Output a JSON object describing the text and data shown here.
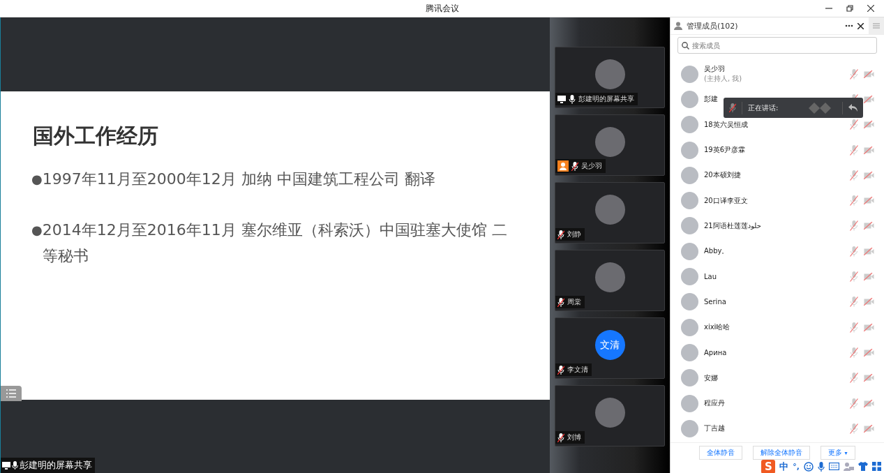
{
  "window": {
    "title": "腾讯会议"
  },
  "slide": {
    "title": "国外工作经历",
    "bullets": [
      {
        "marker": "●",
        "text": "1997年11月至2000年12月  加纳 中国建筑工程公司 翻译"
      },
      {
        "marker": "●",
        "text": "2014年12月至2016年11月  塞尔维亚（科索沃）中国驻塞大使馆 二等秘书"
      }
    ]
  },
  "share_label": {
    "text": "彭建明的屏幕共享",
    "mic_muted": false
  },
  "tiles": [
    {
      "name": "彭建明的屏幕共享",
      "avatar": {
        "kind": "photo"
      },
      "sharing": true,
      "host": false,
      "mic_muted": false
    },
    {
      "name": "吴少羽",
      "avatar": {
        "kind": "photo"
      },
      "sharing": false,
      "host": true,
      "mic_muted": true
    },
    {
      "name": "刘静",
      "avatar": {
        "kind": "photo"
      },
      "sharing": false,
      "host": false,
      "mic_muted": true
    },
    {
      "name": "周棠",
      "avatar": {
        "kind": "photo"
      },
      "sharing": false,
      "host": false,
      "mic_muted": true
    },
    {
      "name": "李文清",
      "avatar": {
        "kind": "initials",
        "text": "文清"
      },
      "sharing": false,
      "host": false,
      "mic_muted": true
    },
    {
      "name": "刘博",
      "avatar": {
        "kind": "photo"
      },
      "sharing": false,
      "host": false,
      "mic_muted": true
    }
  ],
  "members_panel": {
    "title": "管理成员(102)",
    "search": {
      "placeholder": "搜索成员"
    },
    "members": [
      {
        "name": "吴少羽",
        "note": "(主持人, 我)",
        "mic_muted": true,
        "camera_off": true
      },
      {
        "name": "彭建",
        "mic_muted": true,
        "camera_off": true
      },
      {
        "name": "18英六吴恒成",
        "mic_muted": true,
        "camera_off": true
      },
      {
        "name": "19英6尹彦霖",
        "mic_muted": true,
        "camera_off": true
      },
      {
        "name": "20本硕刘捷",
        "mic_muted": true,
        "camera_off": true
      },
      {
        "name": "20口译李亚文",
        "mic_muted": true,
        "camera_off": true
      },
      {
        "name": "21阿语杜莲莲حلود",
        "mic_muted": true,
        "camera_off": true
      },
      {
        "name": "Abby。",
        "mic_muted": true,
        "camera_off": true
      },
      {
        "name": "Lau",
        "mic_muted": true,
        "camera_off": true
      },
      {
        "name": "Serina",
        "mic_muted": true,
        "camera_off": true
      },
      {
        "name": "xixi哈哈",
        "mic_muted": true,
        "camera_off": true
      },
      {
        "name": "Арина",
        "mic_muted": true,
        "camera_off": true
      },
      {
        "name": "安娜",
        "mic_muted": true,
        "camera_off": true
      },
      {
        "name": "程应丹",
        "mic_muted": true,
        "camera_off": true
      },
      {
        "name": "丁吉越",
        "mic_muted": true,
        "camera_off": true
      }
    ],
    "speaking_popup": {
      "label": "正在讲话:",
      "mic_muted": true
    },
    "buttons": [
      "全体静音",
      "解除全体静音"
    ],
    "more_button": {
      "label": "更多",
      "caret": "▾"
    }
  },
  "ime_bar": {
    "logo": "S",
    "mode": "中",
    "punct": "°,"
  }
}
